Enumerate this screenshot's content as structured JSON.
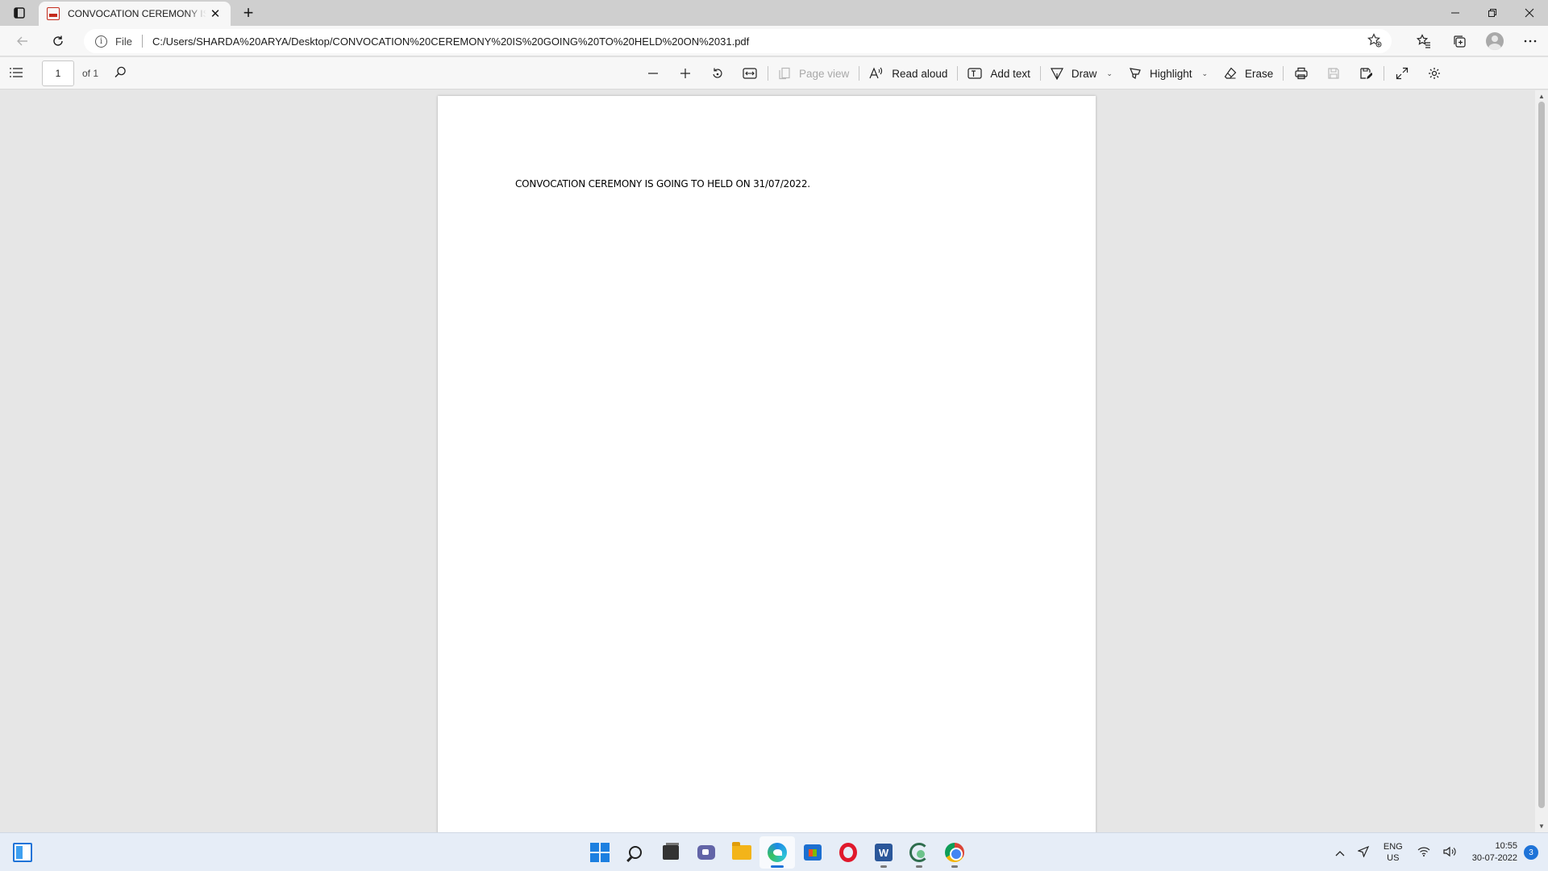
{
  "browser": {
    "tab": {
      "title": "CONVOCATION CEREMONY IS GOING TO HELD ON 31",
      "icon": "pdf-icon"
    },
    "address": {
      "scheme_label": "File",
      "url": "C:/Users/SHARDA%20ARYA/Desktop/CONVOCATION%20CEREMONY%20IS%20GOING%20TO%20HELD%20ON%2031.pdf"
    }
  },
  "pdf_toolbar": {
    "page_current": "1",
    "page_total": "of 1",
    "page_view_label": "Page view",
    "read_aloud_label": "Read aloud",
    "add_text_label": "Add text",
    "draw_label": "Draw",
    "highlight_label": "Highlight",
    "erase_label": "Erase"
  },
  "document": {
    "line1": "CONVOCATION CEREMONY IS GOING TO HELD ON 31/07/2022."
  },
  "taskbar": {
    "word_letter": "W",
    "lang_line1": "ENG",
    "lang_line2": "US",
    "time": "10:55",
    "date": "30-07-2022",
    "notifications": "3"
  },
  "colors": {
    "accent": "#1e73d8",
    "pdf_red": "#c42b1c"
  }
}
